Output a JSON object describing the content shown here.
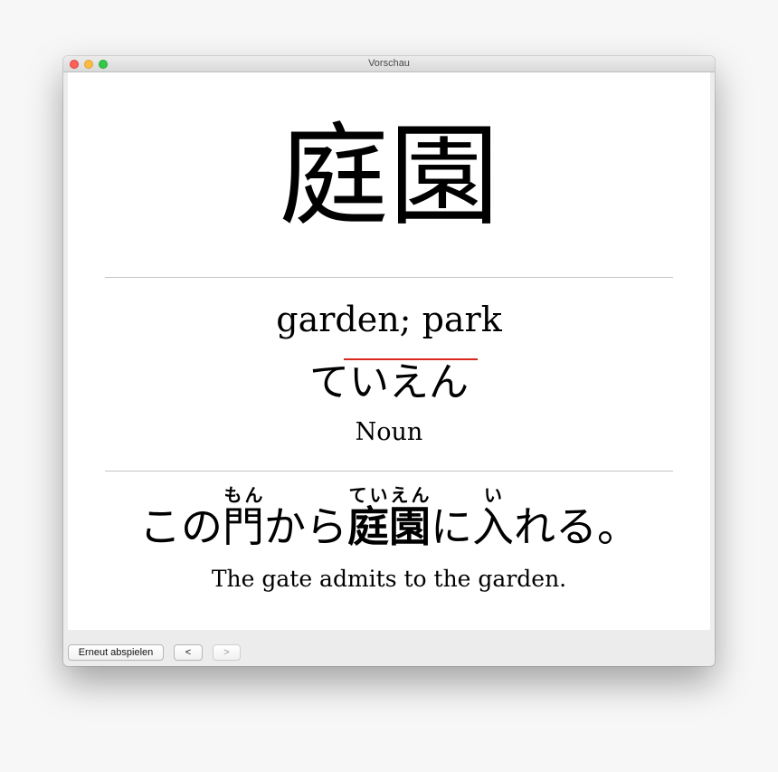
{
  "window": {
    "title": "Vorschau"
  },
  "card": {
    "kanji": "庭園",
    "meaning": "garden; park",
    "reading": "ていえん",
    "part_of_speech": "Noun",
    "sentence": {
      "part1": "この",
      "word1": "門",
      "word1_ruby": "もん",
      "part2": "から",
      "target": "庭園",
      "target_ruby": "ていえん",
      "part3": "に",
      "word2": "入",
      "word2_ruby": "い",
      "part4": "れる。"
    },
    "translation": "The gate admits to the garden."
  },
  "toolbar": {
    "replay_label": "Erneut abspielen",
    "prev_label": "<",
    "next_label": ">"
  },
  "colors": {
    "accent_line": "#d9281c",
    "close": "#fc605b",
    "minimize": "#fdbc40",
    "zoom": "#34c84a"
  }
}
